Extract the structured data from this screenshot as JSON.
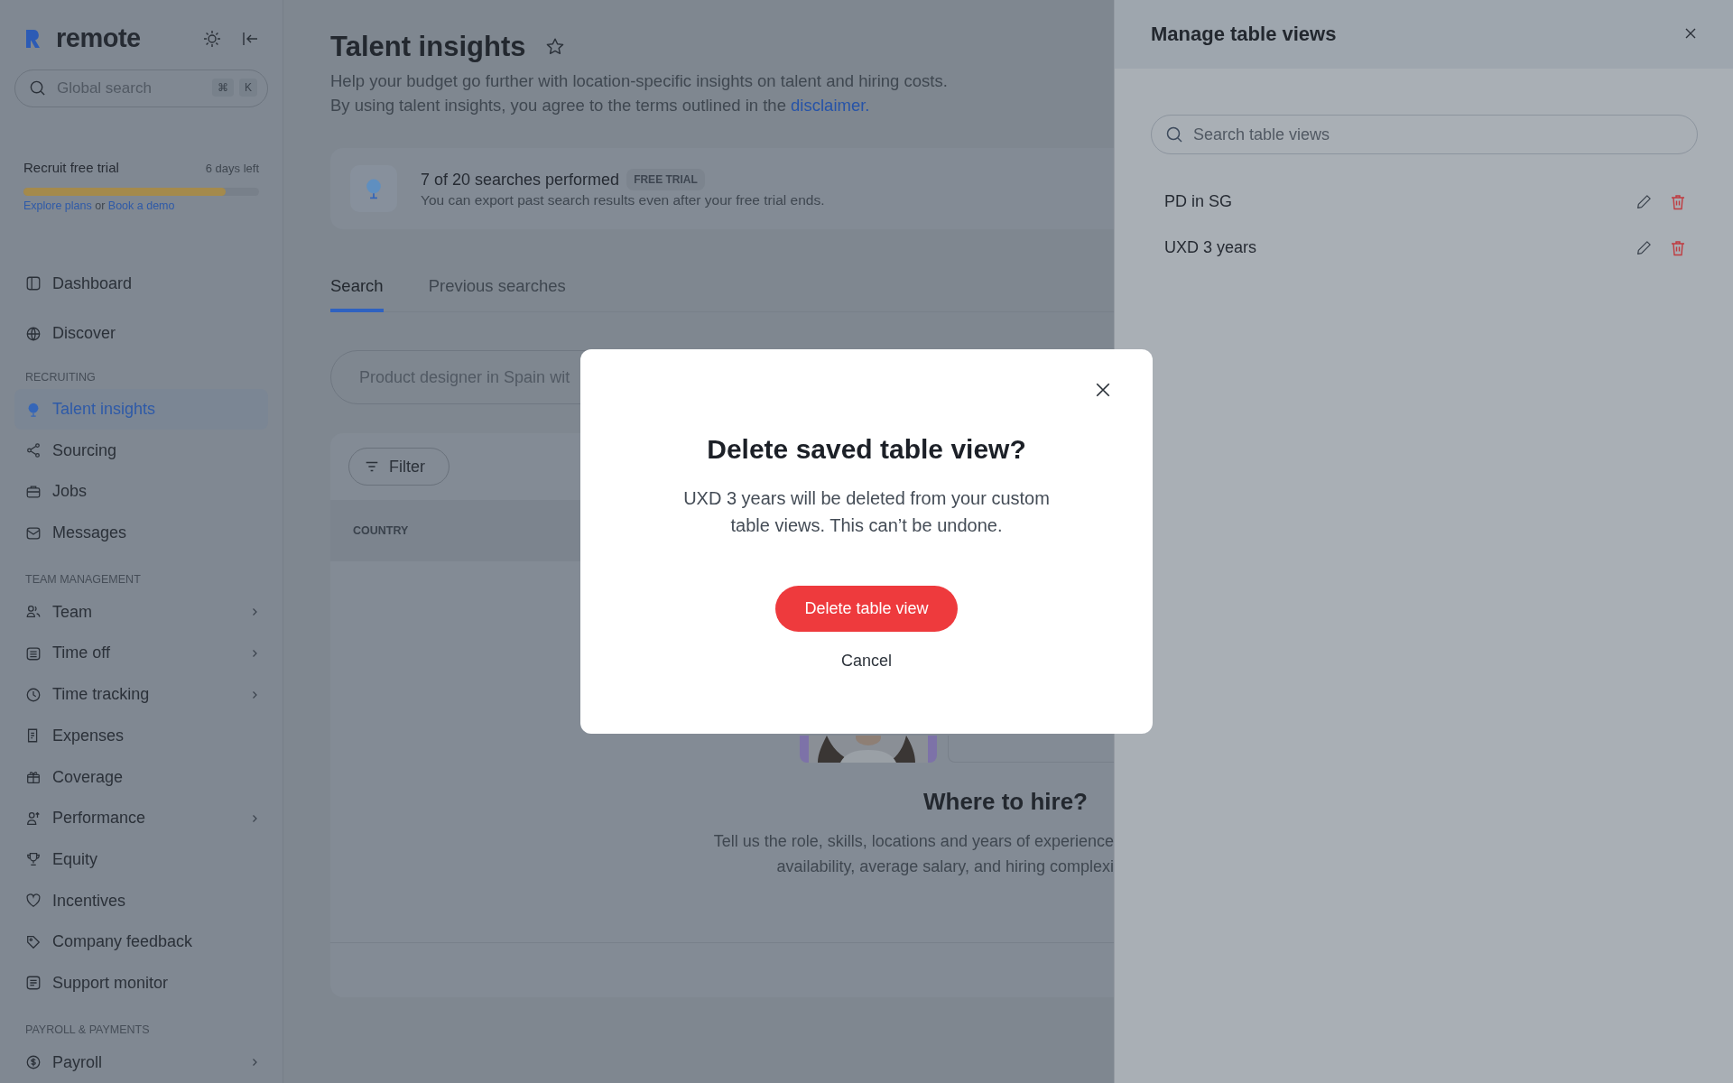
{
  "sidebar": {
    "brand": "remote",
    "search": {
      "placeholder": "Global search",
      "keys": [
        "⌘",
        "K"
      ]
    },
    "trial": {
      "title": "Recruit free trial",
      "days_left": "6 days left",
      "level": 0.86,
      "links": [
        "Explore plans",
        "Book a demo"
      ],
      "joiner": "or"
    },
    "sections": [
      {
        "items": [
          {
            "label": "Dashboard",
            "selected": false,
            "expandable": false
          },
          {
            "label": "Discover",
            "selected": false,
            "expandable": false
          }
        ]
      },
      {
        "heading": "RECRUITING",
        "items": [
          {
            "label": "Talent insights",
            "selected": true,
            "expandable": false
          },
          {
            "label": "Sourcing",
            "selected": false,
            "expandable": false
          },
          {
            "label": "Jobs",
            "selected": false,
            "expandable": false
          },
          {
            "label": "Messages",
            "selected": false,
            "expandable": false
          }
        ]
      },
      {
        "heading": "TEAM MANAGEMENT",
        "items": [
          {
            "label": "Team",
            "selected": false,
            "expandable": true
          },
          {
            "label": "Time off",
            "selected": false,
            "expandable": true
          },
          {
            "label": "Time tracking",
            "selected": false,
            "expandable": true
          },
          {
            "label": "Expenses",
            "selected": false,
            "expandable": false
          },
          {
            "label": "Coverage",
            "selected": false,
            "expandable": false
          },
          {
            "label": "Performance",
            "selected": false,
            "expandable": true
          },
          {
            "label": "Equity",
            "selected": false,
            "expandable": false
          },
          {
            "label": "Incentives",
            "selected": false,
            "expandable": false
          },
          {
            "label": "Company feedback",
            "selected": false,
            "expandable": false
          },
          {
            "label": "Support monitor",
            "selected": false,
            "expandable": false
          }
        ]
      },
      {
        "heading": "PAYROLL & PAYMENTS",
        "items": [
          {
            "label": "Payroll",
            "selected": false,
            "expandable": true
          }
        ]
      }
    ]
  },
  "main": {
    "title": "Talent insights",
    "description": "Help your budget go further with location-specific insights on talent and hiring costs.",
    "terms": "By using talent insights, you agree to the terms outlined in the",
    "terms_link": "disclaimer.",
    "usage": {
      "title": "7 of 20 searches performed",
      "badge": "FREE TRIAL",
      "note": "You can export past search results even after your free trial ends."
    },
    "tabs": [
      {
        "label": "Search",
        "selected": true
      },
      {
        "label": "Previous searches",
        "selected": false
      }
    ],
    "search": {
      "placeholder": "Product designer in Spain wit"
    },
    "filter": "Filter",
    "table": {
      "columns": [
        "COUNTRY"
      ]
    },
    "empty": {
      "title": "Where to hire?",
      "lines": [
        "Tell us the role, skills, locations and years of experience",
        "availability, average salary, and hiring complexi"
      ]
    }
  },
  "panel": {
    "title": "Manage table views",
    "search": {
      "placeholder": "Search table views"
    },
    "views": [
      {
        "name": "PD in SG"
      },
      {
        "name": "UXD 3 years"
      }
    ]
  },
  "modal": {
    "title": "Delete saved table view?",
    "message": "UXD 3 years will be deleted from your custom table views. This can’t be undone.",
    "confirm": "Delete table view",
    "cancel": "Cancel"
  }
}
